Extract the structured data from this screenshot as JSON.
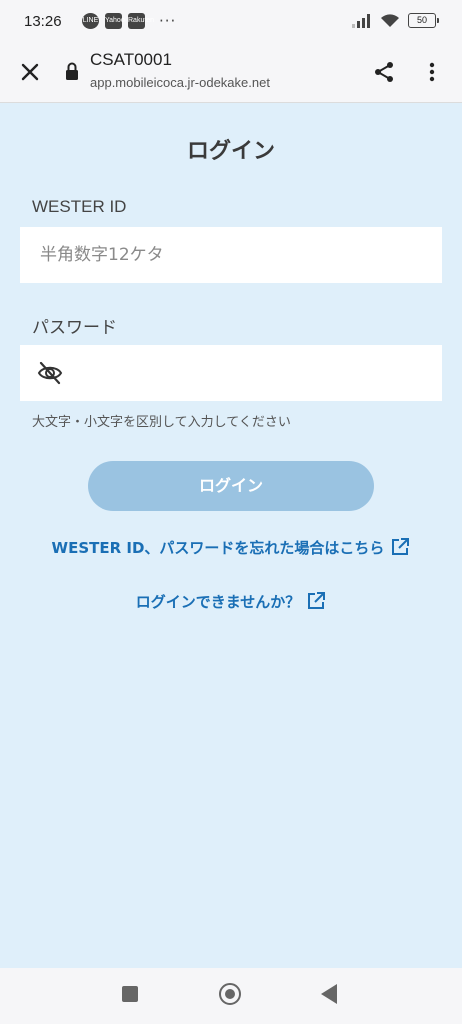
{
  "status_bar": {
    "time": "13:26",
    "notifications": [
      "LINE",
      "Yahoo",
      "Rakuten"
    ],
    "more": "···",
    "battery": "50"
  },
  "browser": {
    "page_title": "CSAT0001",
    "host": "app.mobileicoca.jr-odekake.net",
    "icons": [
      "close-icon",
      "lock-icon",
      "share-icon",
      "more-vert-icon"
    ]
  },
  "login": {
    "title": "ログイン",
    "wester_id_label": "WESTER ID",
    "wester_id_placeholder": "半角数字12ケタ",
    "wester_id_value": "",
    "password_label": "パスワード",
    "password_value": "",
    "password_hint": "大文字・小文字を区別して入力してください",
    "login_button": "ログイン",
    "forgot_link": "WESTER ID、パスワードを忘れた場合はこちら",
    "cant_login_link": "ログインできませんか？"
  },
  "colors": {
    "background": "#dfeffa",
    "button": "#9ac3e1",
    "link": "#1a6fb5"
  }
}
